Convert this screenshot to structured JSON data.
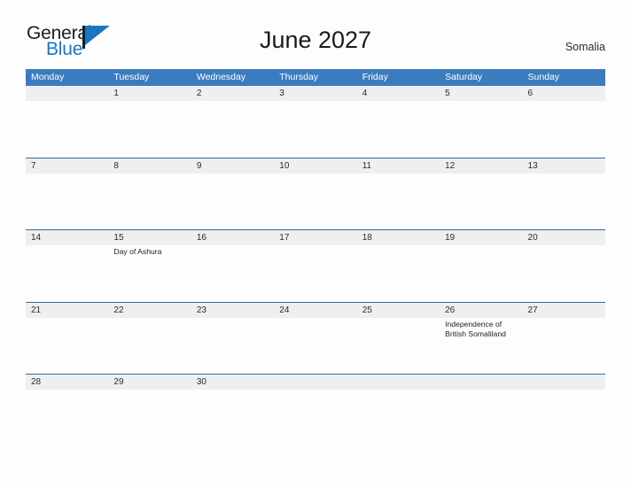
{
  "brand": {
    "word_one": "General",
    "word_two": "Blue",
    "flag_icon": "flag-triangle-icon",
    "accent_color": "#1977c2"
  },
  "header": {
    "title": "June 2027",
    "country": "Somalia"
  },
  "colors": {
    "header_blue": "#3b7cbf",
    "row_divider": "#2e6ca4",
    "day_band": "#efefef",
    "page_background": "#fdfdfd"
  },
  "calendar": {
    "weekdays": [
      "Monday",
      "Tuesday",
      "Wednesday",
      "Thursday",
      "Friday",
      "Saturday",
      "Sunday"
    ],
    "weeks": [
      [
        {
          "day": "",
          "event": ""
        },
        {
          "day": "1",
          "event": ""
        },
        {
          "day": "2",
          "event": ""
        },
        {
          "day": "3",
          "event": ""
        },
        {
          "day": "4",
          "event": ""
        },
        {
          "day": "5",
          "event": ""
        },
        {
          "day": "6",
          "event": ""
        }
      ],
      [
        {
          "day": "7",
          "event": ""
        },
        {
          "day": "8",
          "event": ""
        },
        {
          "day": "9",
          "event": ""
        },
        {
          "day": "10",
          "event": ""
        },
        {
          "day": "11",
          "event": ""
        },
        {
          "day": "12",
          "event": ""
        },
        {
          "day": "13",
          "event": ""
        }
      ],
      [
        {
          "day": "14",
          "event": ""
        },
        {
          "day": "15",
          "event": "Day of Ashura"
        },
        {
          "day": "16",
          "event": ""
        },
        {
          "day": "17",
          "event": ""
        },
        {
          "day": "18",
          "event": ""
        },
        {
          "day": "19",
          "event": ""
        },
        {
          "day": "20",
          "event": ""
        }
      ],
      [
        {
          "day": "21",
          "event": ""
        },
        {
          "day": "22",
          "event": ""
        },
        {
          "day": "23",
          "event": ""
        },
        {
          "day": "24",
          "event": ""
        },
        {
          "day": "25",
          "event": ""
        },
        {
          "day": "26",
          "event": "Independence of British Somaliland"
        },
        {
          "day": "27",
          "event": ""
        }
      ],
      [
        {
          "day": "28",
          "event": ""
        },
        {
          "day": "29",
          "event": ""
        },
        {
          "day": "30",
          "event": ""
        },
        {
          "day": "",
          "event": ""
        },
        {
          "day": "",
          "event": ""
        },
        {
          "day": "",
          "event": ""
        },
        {
          "day": "",
          "event": ""
        }
      ]
    ]
  }
}
